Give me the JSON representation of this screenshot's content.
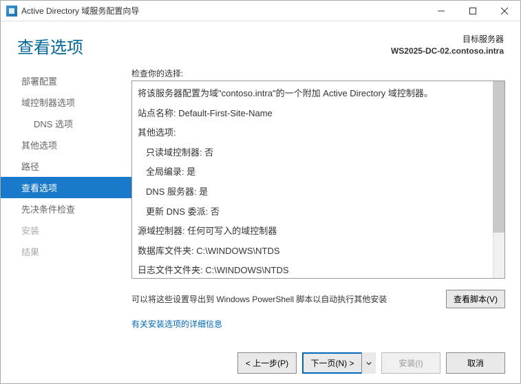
{
  "window": {
    "title": "Active Directory 域服务配置向导"
  },
  "header": {
    "heading": "查看选项",
    "target_label": "目标服务器",
    "target_value": "WS2025-DC-02.contoso.intra"
  },
  "sidebar": {
    "items": [
      {
        "label": "部署配置",
        "state": "normal"
      },
      {
        "label": "域控制器选项",
        "state": "normal"
      },
      {
        "label": "DNS 选项",
        "state": "sub"
      },
      {
        "label": "其他选项",
        "state": "normal"
      },
      {
        "label": "路径",
        "state": "normal"
      },
      {
        "label": "查看选项",
        "state": "active"
      },
      {
        "label": "先决条件检查",
        "state": "normal"
      },
      {
        "label": "安装",
        "state": "disabled"
      },
      {
        "label": "结果",
        "state": "disabled"
      }
    ]
  },
  "main": {
    "review_label": "检查你的选择:",
    "export_text": "可以将这些设置导出到 Windows PowerShell 脚本以自动执行其他安装",
    "view_script_button": "查看脚本(V)",
    "more_info_link": "有关安装选项的详细信息"
  },
  "review": {
    "line1": "将该服务器配置为域\"contoso.intra\"的一个附加 Active Directory 域控制器。",
    "line2": "站点名称: Default-First-Site-Name",
    "line3": "其他选项:",
    "line4": "只读域控制器: 否",
    "line5": "全局编录: 是",
    "line6": "DNS 服务器: 是",
    "line7": "更新 DNS 委派: 否",
    "line8": "源域控制器: 任何可写入的域控制器",
    "line9": "数据库文件夹: C:\\WINDOWS\\NTDS",
    "line10": "日志文件文件夹: C:\\WINDOWS\\NTDS"
  },
  "footer": {
    "prev": "< 上一步(P)",
    "next": "下一页(N) >",
    "install": "安装(I)",
    "cancel": "取消"
  }
}
